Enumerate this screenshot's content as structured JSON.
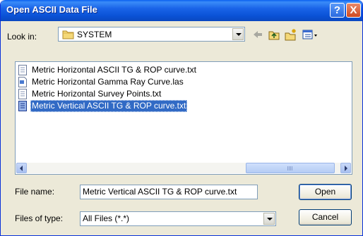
{
  "window": {
    "title": "Open ASCII Data File"
  },
  "titlebar": {
    "help_label": "?",
    "close_label": "X"
  },
  "look_in": {
    "label": "Look in:",
    "value": "SYSTEM"
  },
  "toolbar": {
    "icons": [
      "back-arrow-icon",
      "up-folder-icon",
      "new-folder-icon",
      "view-menu-icon"
    ]
  },
  "files": [
    {
      "name": "Metric Horizontal ASCII TG & ROP curve.txt",
      "icon": "text-file-icon",
      "selected": false
    },
    {
      "name": "Metric Horizontal Gamma Ray Curve.las",
      "icon": "las-file-icon",
      "selected": false
    },
    {
      "name": "Metric Horizontal Survey Points.txt",
      "icon": "text-file-icon",
      "selected": false
    },
    {
      "name": "Metric Vertical ASCII TG & ROP curve.txt",
      "icon": "text-file-icon",
      "selected": true
    }
  ],
  "file_name": {
    "label": "File name:",
    "value": "Metric Vertical ASCII TG & ROP curve.txt"
  },
  "file_type": {
    "label": "Files of type:",
    "value": "All Files (*.*)"
  },
  "buttons": {
    "open": "Open",
    "cancel": "Cancel"
  },
  "colors": {
    "titlebar": "#0a52d6",
    "selection": "#316ac5",
    "dialog_bg": "#ece9d8"
  }
}
